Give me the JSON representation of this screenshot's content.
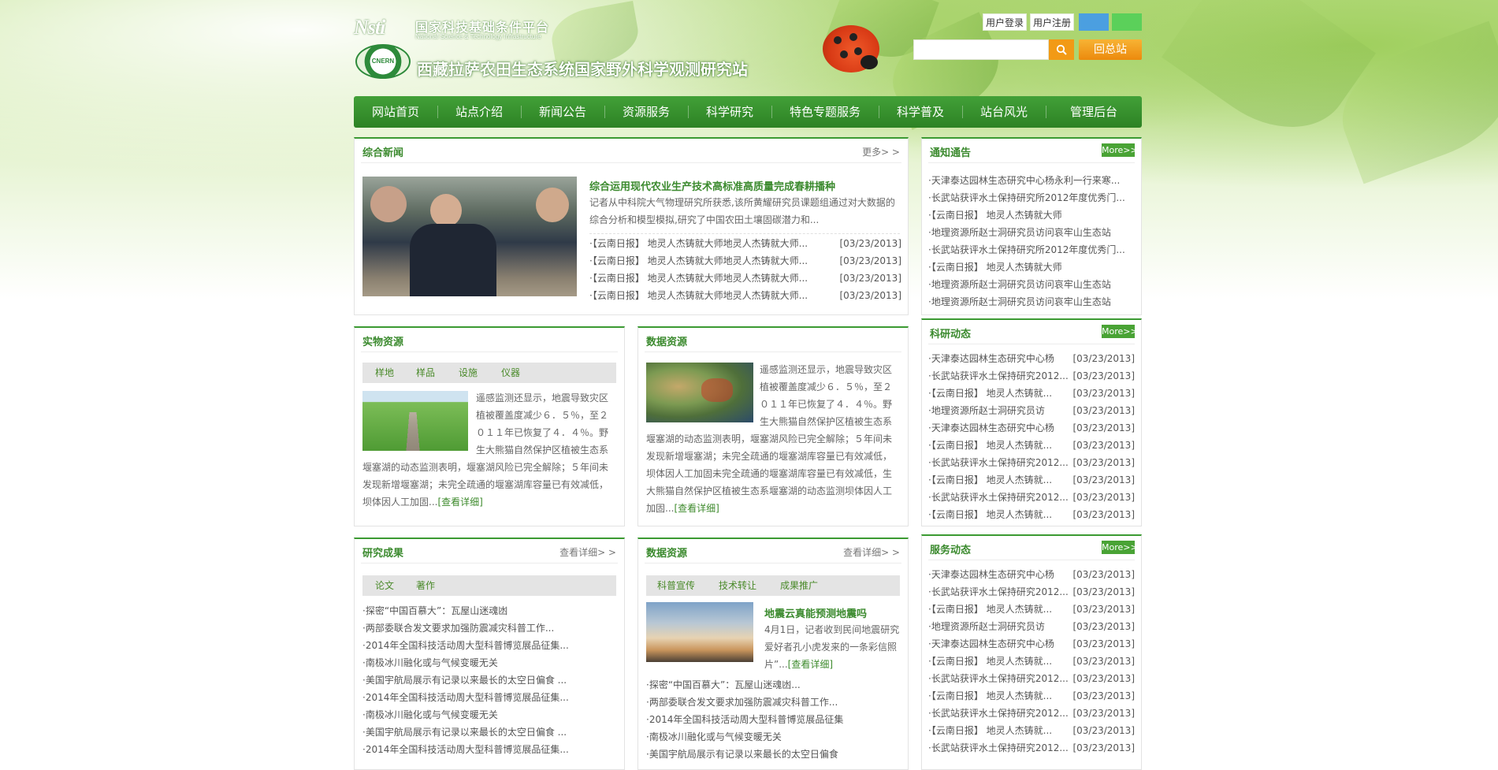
{
  "header": {
    "nsti_logo": "Nsti",
    "platform_name_cn": "国家科技基础条件平台",
    "platform_name_en": "National Science & Technology Infrastructure",
    "cnern_logo": "CNERN",
    "site_title": "西藏拉萨农田生态系统国家野外科学观测研究站",
    "login_label": "用户登录",
    "register_label": "用户注册",
    "search_placeholder": "",
    "back_label": "回总站",
    "colors": {
      "theme_blue": "#4b9fe0",
      "theme_green": "#5bd05a",
      "accent": "#f29a15"
    }
  },
  "nav": {
    "items": [
      "网站首页",
      "站点介绍",
      "新闻公告",
      "资源服务",
      "科学研究",
      "特色专题服务",
      "科学普及",
      "站台风光",
      "管理后台"
    ]
  },
  "news": {
    "title": "综合新闻",
    "more": "更多> >",
    "headline": "综合运用现代农业生产技术高标准高质量完成春耕播种",
    "summary_1": "记者从中科院大气物理研究所获悉,该所黄耀研究员课题组通过对大数据的",
    "summary_2": "综合分析和模型模拟,研究了中国农田土壤固碳潜力和...",
    "items": [
      {
        "title": "·【云南日报】 地灵人杰铸就大师地灵人杰铸就大师...",
        "date": "[03/23/2013]"
      },
      {
        "title": "·【云南日报】 地灵人杰铸就大师地灵人杰铸就大师...",
        "date": "[03/23/2013]"
      },
      {
        "title": "·【云南日报】 地灵人杰铸就大师地灵人杰铸就大师...",
        "date": "[03/23/2013]"
      },
      {
        "title": "·【云南日报】 地灵人杰铸就大师地灵人杰铸就大师...",
        "date": "[03/23/2013]"
      }
    ]
  },
  "physical": {
    "title": "实物资源",
    "tabs": [
      "样地",
      "样品",
      "设施",
      "仪器"
    ],
    "lines": [
      "遥感监测还显示，地震导致灾区",
      "植被覆盖度减少６．５％，至２",
      "０１１年已恢复了４．４％。野",
      "生大熊猫自然保护区植被生态系",
      "堰塞湖的动态监测表明，堰塞湖风险已完全解除；５年间未",
      "发现新增堰塞湖；未完全疏通的堰塞湖库容量已有效减低，",
      "坝体因人工加固..."
    ],
    "detail": "[查看详细]"
  },
  "data_res": {
    "title": "数据资源",
    "lines": [
      "遥感监测还显示，地震导致灾区",
      "植被覆盖度减少６．５％，至２",
      "０１１年已恢复了４．４％。野",
      "生大熊猫自然保护区植被生态系",
      "堰塞湖的动态监测表明，堰塞湖风险已完全解除；５年间未",
      "发现新增堰塞湖；未完全疏通的堰塞湖库容量已有效减低，",
      "坝体因人工加固未完全疏通的堰塞湖库容量已有效减低，生",
      "大熊猫自然保护区植被生态系堰塞湖的动态监测坝体因人工",
      "加固..."
    ],
    "detail": "[查看详细]"
  },
  "research": {
    "title": "研究成果",
    "more": "查看详细> >",
    "tabs": [
      "论文",
      "著作"
    ],
    "items": [
      "·探密“中国百慕大”：瓦屋山迷魂凼",
      "·两部委联合发文要求加强防震减灾科普工作...",
      "·2014年全国科技活动周大型科普博览展品征集...",
      "·南极冰川融化或与气候变暖无关",
      "·美国宇航局展示有记录以来最长的太空日偏食 ...",
      "·2014年全国科技活动周大型科普博览展品征集...",
      "·南极冰川融化或与气候变暖无关",
      "·美国宇航局展示有记录以来最长的太空日偏食 ...",
      "·2014年全国科技活动周大型科普博览展品征集..."
    ]
  },
  "data_res2": {
    "title": "数据资源",
    "more": "查看详细> >",
    "tabs": [
      "科普宣传",
      "技术转让",
      "成果推广"
    ],
    "headline": "地震云真能预测地震吗",
    "lines": [
      "4月1日，记者收到民间地震研究",
      "爱好者孔小虎发来的一条彩信照",
      "片”..."
    ],
    "detail": "[查看详细]",
    "items": [
      "·探密“中国百慕大”：瓦屋山迷魂凼...",
      "·两部委联合发文要求加强防震减灾科普工作...",
      "·2014年全国科技活动周大型科普博览展品征集",
      "·南极冰川融化或与气候变暖无关",
      "·美国宇航局展示有记录以来最长的太空日偏食"
    ]
  },
  "notice": {
    "title": "通知通告",
    "more": "More>>",
    "items": [
      "·天津泰达园林生态研究中心杨永利一行来寒...",
      "·长武站获评水土保持研究所2012年度优秀门...",
      "·【云南日报】 地灵人杰铸就大师",
      "·地理资源所赵士洞研究员访问哀牢山生态站",
      "·长武站获评水土保持研究所2012年度优秀门...",
      "·【云南日报】 地灵人杰铸就大师",
      "·地理资源所赵士洞研究员访问哀牢山生态站",
      "·地理资源所赵士洞研究员访问哀牢山生态站"
    ]
  },
  "research_news": {
    "title": "科研动态",
    "more": "More>>",
    "items": [
      {
        "title": "·天津泰达园林生态研究中心杨",
        "date": "[03/23/2013]"
      },
      {
        "title": "·长武站获评水土保持研究2012...",
        "date": "[03/23/2013]"
      },
      {
        "title": "·【云南日报】 地灵人杰铸就...",
        "date": "[03/23/2013]"
      },
      {
        "title": "·地理资源所赵士洞研究员访",
        "date": "[03/23/2013]"
      },
      {
        "title": "·天津泰达园林生态研究中心杨",
        "date": "[03/23/2013]"
      },
      {
        "title": "·【云南日报】 地灵人杰铸就...",
        "date": "[03/23/2013]"
      },
      {
        "title": "·长武站获评水土保持研究2012...",
        "date": "[03/23/2013]"
      },
      {
        "title": "·【云南日报】 地灵人杰铸就...",
        "date": "[03/23/2013]"
      },
      {
        "title": "·长武站获评水土保持研究2012...",
        "date": "[03/23/2013]"
      },
      {
        "title": "·【云南日报】 地灵人杰铸就...",
        "date": "[03/23/2013]"
      }
    ]
  },
  "service_news": {
    "title": "服务动态",
    "more": "More>>",
    "items": [
      {
        "title": "·天津泰达园林生态研究中心杨",
        "date": "[03/23/2013]"
      },
      {
        "title": "·长武站获评水土保持研究2012...",
        "date": "[03/23/2013]"
      },
      {
        "title": "·【云南日报】 地灵人杰铸就...",
        "date": "[03/23/2013]"
      },
      {
        "title": "·地理资源所赵士洞研究员访",
        "date": "[03/23/2013]"
      },
      {
        "title": "·天津泰达园林生态研究中心杨",
        "date": "[03/23/2013]"
      },
      {
        "title": "·【云南日报】 地灵人杰铸就...",
        "date": "[03/23/2013]"
      },
      {
        "title": "·长武站获评水土保持研究2012...",
        "date": "[03/23/2013]"
      },
      {
        "title": "·【云南日报】 地灵人杰铸就...",
        "date": "[03/23/2013]"
      },
      {
        "title": "·长武站获评水土保持研究2012...",
        "date": "[03/23/2013]"
      },
      {
        "title": "·【云南日报】 地灵人杰铸就...",
        "date": "[03/23/2013]"
      },
      {
        "title": "·长武站获评水土保持研究2012...",
        "date": "[03/23/2013]"
      }
    ]
  }
}
